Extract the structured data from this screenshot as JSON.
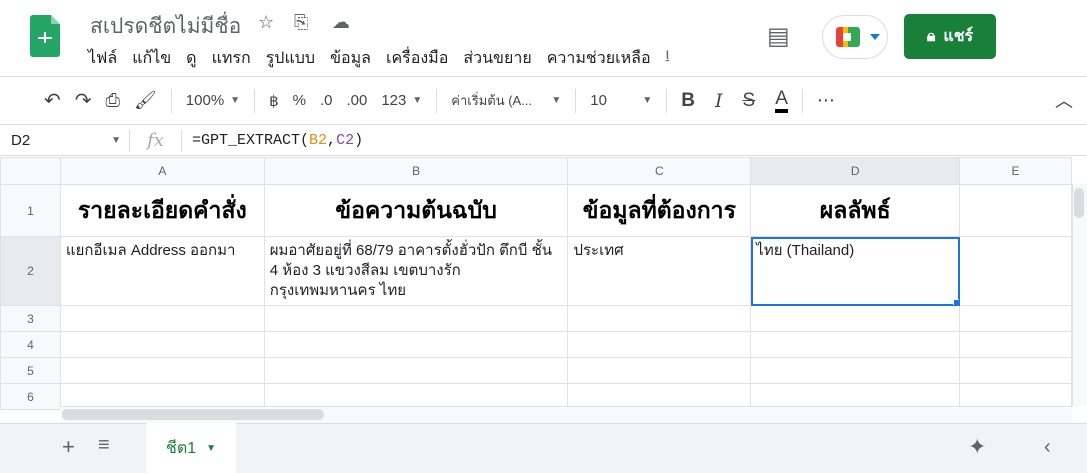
{
  "doc": {
    "title": "สเปรดชีตไม่มีชื่อ",
    "share_label": "แชร์"
  },
  "menu": [
    "ไฟล์",
    "แก้ไข",
    "ดู",
    "แทรก",
    "รูปแบบ",
    "ข้อมูล",
    "เครื่องมือ",
    "ส่วนขยาย",
    "ความช่วยเหลือ",
    "ι"
  ],
  "toolbar": {
    "zoom": "100%",
    "currency": "฿",
    "percent": "%",
    "dec_less": ".0",
    "dec_more": ".00",
    "format": "123",
    "font": "ค่าเริ่มต้น (A...",
    "size": "10",
    "bold": "B",
    "italic": "I",
    "strike": "S",
    "color": "A",
    "more": "⋯"
  },
  "formula_bar": {
    "cell": "D2",
    "fx": "fx",
    "prefix": "=GPT_EXTRACT(",
    "ref1": "B2",
    "comma": ",",
    "ref2": "C2",
    "suffix": ")"
  },
  "columns": [
    "A",
    "B",
    "C",
    "D",
    "E"
  ],
  "rows": [
    "1",
    "2",
    "3",
    "4",
    "5",
    "6"
  ],
  "cells": {
    "A1": "รายละเอียดคำสั่ง",
    "B1": "ข้อความต้นฉบับ",
    "C1": "ข้อมูลที่ต้องการ",
    "D1": "ผลลัพธ์",
    "A2": "แยกอีเมล Address ออกมา",
    "B2": "ผมอาศัยอยู่ที่ 68/79 อาคารตั้งฮั่วปัก ตึกบี ชั้น 4 ห้อง 3 แขวงสีลม เขตบางรัก กรุงเทพมหานคร ไทย",
    "C2": "ประเทศ",
    "D2": "ไทย (Thailand)"
  },
  "sheets": [
    {
      "label": "ชีต1"
    }
  ],
  "colors": {
    "accent": "#188038",
    "selection": "#1a73e8"
  }
}
